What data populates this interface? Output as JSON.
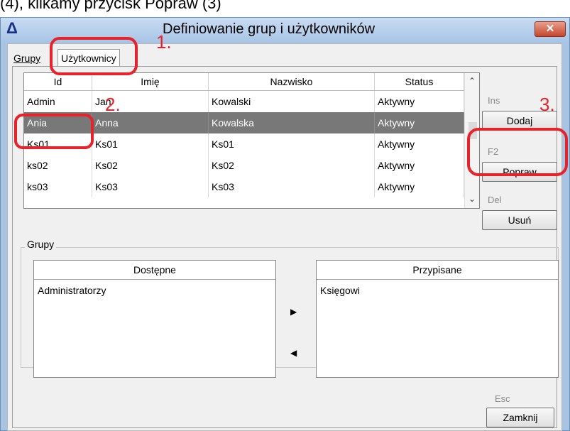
{
  "top_caption": "(4), klikamy przycisk Popraw (3)",
  "window": {
    "title": "Definiowanie grup i użytkowników",
    "close_glyph": "✕",
    "app_icon": "delta-icon"
  },
  "tabs": [
    {
      "label": "Grupy"
    },
    {
      "label": "Użytkownicy"
    }
  ],
  "users_table": {
    "columns": [
      "Id",
      "Imię",
      "Nazwisko",
      "Status"
    ],
    "rows": [
      {
        "id": "Admin",
        "imie": "Jan",
        "nazwisko": "Kowalski",
        "status": "Aktywny"
      },
      {
        "id": "Ania",
        "imie": "Anna",
        "nazwisko": "Kowalska",
        "status": "Aktywny"
      },
      {
        "id": "Ks01",
        "imie": "Ks01",
        "nazwisko": "Ks01",
        "status": "Aktywny"
      },
      {
        "id": "ks02",
        "imie": "Ks02",
        "nazwisko": "Ks02",
        "status": "Aktywny"
      },
      {
        "id": "ks03",
        "imie": "Ks03",
        "nazwisko": "Ks03",
        "status": "Aktywny"
      }
    ],
    "selected_row": 1
  },
  "actions": {
    "add_hint": "Ins",
    "add_label": "Dodaj",
    "edit_hint": "F2",
    "edit_label": "Popraw",
    "delete_hint": "Del",
    "delete_label": "Usuń",
    "close_hint": "Esc",
    "close_label": "Zamknij"
  },
  "groups": {
    "label": "Grupy",
    "available": {
      "header": "Dostępne",
      "items": [
        "Administratorzy"
      ]
    },
    "assigned": {
      "header": "Przypisane",
      "items": [
        "Księgowi"
      ]
    },
    "move_right_glyph": "▶",
    "move_left_glyph": "◀"
  },
  "annotations": {
    "step1": "1.",
    "step2": "2.",
    "step3": "3.",
    "color": "#e8222a"
  }
}
